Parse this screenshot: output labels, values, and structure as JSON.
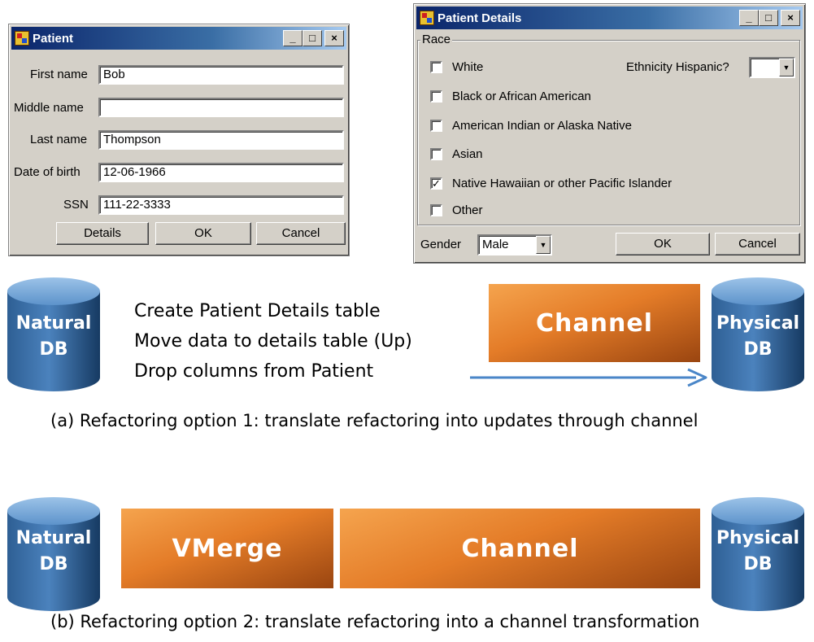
{
  "patient_window": {
    "title": "Patient",
    "first_name_label": "First name",
    "first_name_value": "Bob",
    "middle_name_label": "Middle name",
    "middle_name_value": "",
    "last_name_label": "Last name",
    "last_name_value": "Thompson",
    "dob_label": "Date of birth",
    "dob_value": "12-06-1966",
    "ssn_label": "SSN",
    "ssn_value": "111-22-3333",
    "details_button": "Details",
    "ok_button": "OK",
    "cancel_button": "Cancel"
  },
  "details_window": {
    "title": "Patient Details",
    "race_group": "Race",
    "ethnicity_label": "Ethnicity Hispanic?",
    "ethnicity_value": "",
    "races": [
      {
        "label": "White",
        "checked": false
      },
      {
        "label": "Black or African American",
        "checked": false
      },
      {
        "label": "American Indian or Alaska Native",
        "checked": false
      },
      {
        "label": "Asian",
        "checked": false
      },
      {
        "label": "Native Hawaiian or other Pacific Islander",
        "checked": true
      },
      {
        "label": "Other",
        "checked": false
      }
    ],
    "gender_label": "Gender",
    "gender_value": "Male",
    "ok_button": "OK",
    "cancel_button": "Cancel"
  },
  "diagram_a": {
    "natural_db": {
      "line1": "Natural",
      "line2": "DB"
    },
    "steps": [
      "Create Patient Details table",
      "Move data to details table (Up)",
      "Drop columns from Patient"
    ],
    "channel": "Channel",
    "physical_db": {
      "line1": "Physical",
      "line2": "DB"
    },
    "caption": "(a)  Refactoring option 1: translate refactoring into updates through channel"
  },
  "diagram_b": {
    "natural_db": {
      "line1": "Natural",
      "line2": "DB"
    },
    "vmerge": "VMerge",
    "channel": "Channel",
    "physical_db": {
      "line1": "Physical",
      "line2": "DB"
    },
    "caption": "(b)  Refactoring option 2: translate refactoring into a channel transformation"
  },
  "colors": {
    "db_blue_light": "#6fa0d0",
    "db_blue_dark": "#1b4470",
    "orange_light": "#f5a44e",
    "orange_dark": "#9a4510",
    "arrow_blue": "#4a86c8"
  }
}
